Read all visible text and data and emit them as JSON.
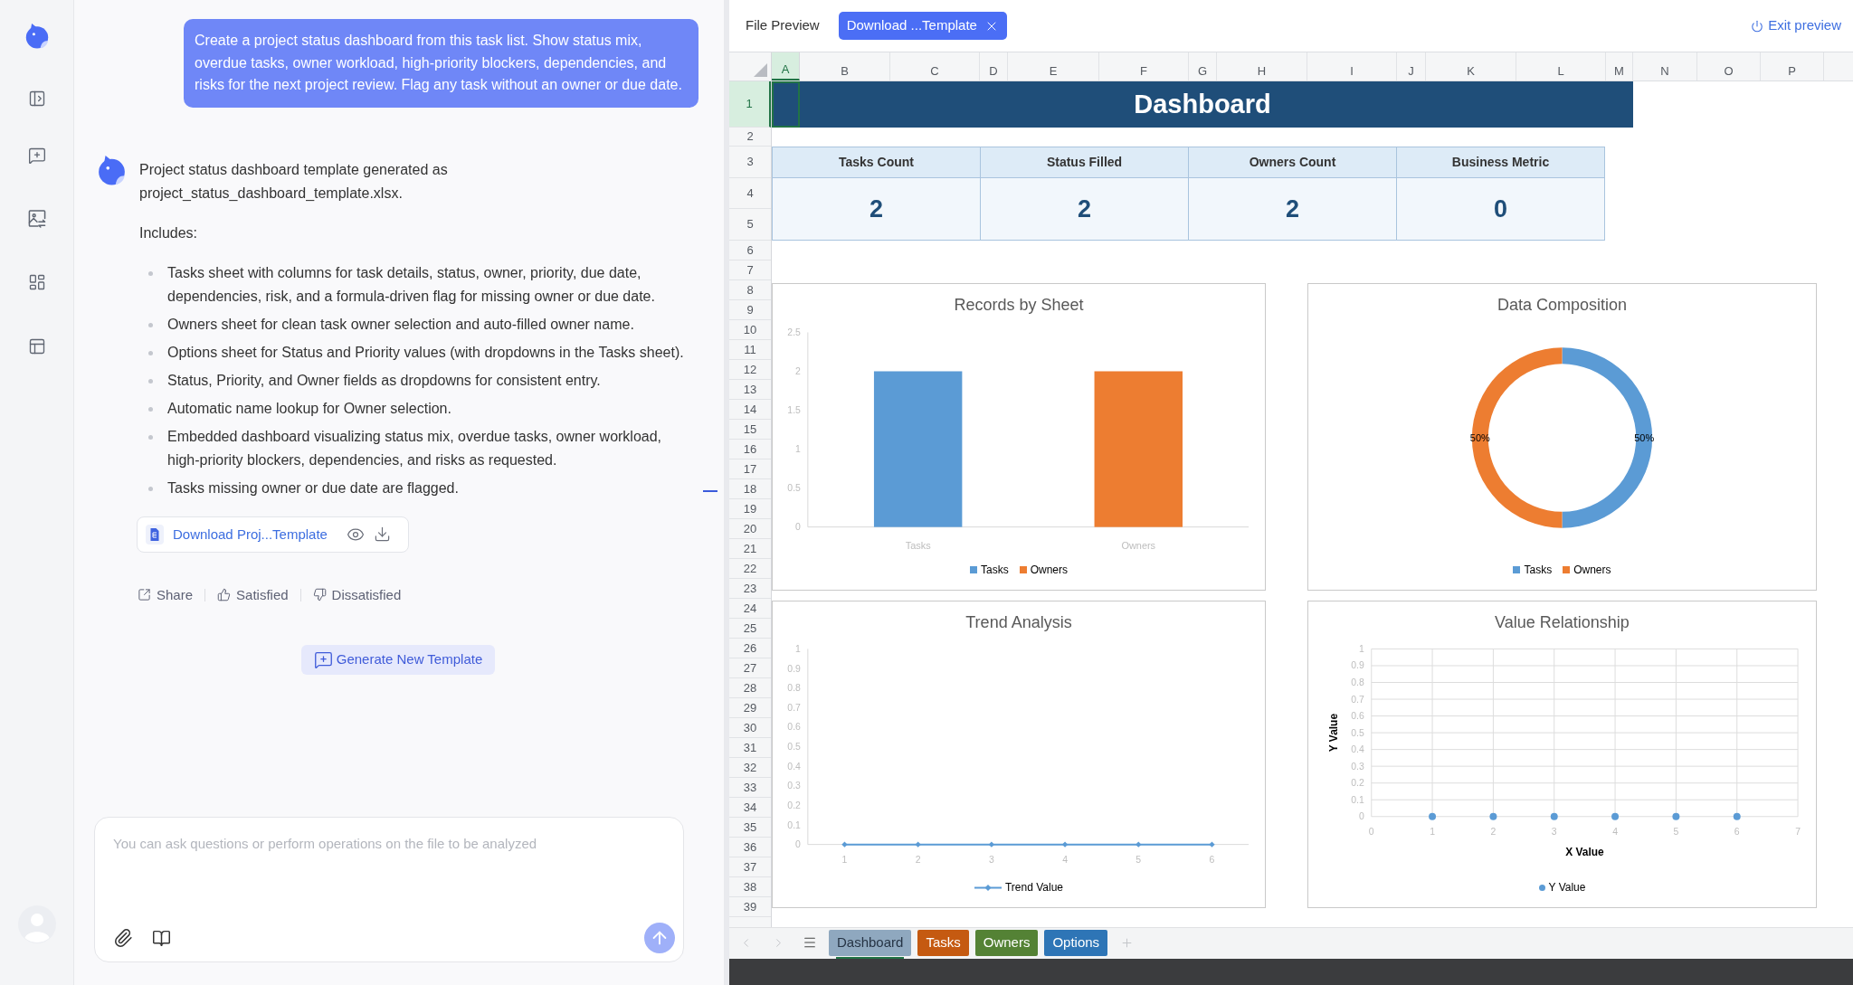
{
  "chat": {
    "user_message": "Create a project status dashboard from this task list. Show status mix, overdue tasks, owner workload, high-priority blockers, dependencies, and risks for the next project review. Flag any task without an owner or due date.",
    "reply": {
      "intro": "Project status dashboard template generated as project_status_dashboard_template.xlsx.",
      "list_heading": "Includes:",
      "bullets": [
        "Tasks sheet with columns for task details, status, owner, priority, due date, dependencies, risk, and a formula-driven flag for missing owner or due date.",
        "Owners sheet for clean task owner selection and auto-filled owner name.",
        "Options sheet for Status and Priority values (with dropdowns in the Tasks sheet).",
        "Status, Priority, and Owner fields as dropdowns for consistent entry.",
        "Automatic name lookup for Owner selection.",
        "Embedded dashboard visualizing status mix, overdue tasks, owner workload, high-priority blockers, dependencies, and risks as requested.",
        "Tasks missing owner or due date are flagged."
      ],
      "attachment": {
        "label": "Download Proj...Template"
      },
      "actions": [
        {
          "kind": "share",
          "label": "Share"
        },
        {
          "kind": "like",
          "label": "Satisfied"
        },
        {
          "kind": "dislike",
          "label": "Dissatisfied"
        }
      ]
    },
    "generate_button": {
      "label": "Generate New Template"
    },
    "composer": {
      "placeholder": "You can ask questions or perform operations on the file to be analyzed"
    }
  },
  "preview": {
    "title": "File Preview",
    "file_tab": {
      "label": "Download ...Template"
    },
    "exit_button": {
      "label": "Exit preview"
    },
    "columns": [
      {
        "label": "A",
        "selected": true
      },
      {
        "label": "B",
        "selected": false
      },
      {
        "label": "C",
        "selected": false
      },
      {
        "label": "D",
        "selected": false
      },
      {
        "label": "E",
        "selected": false
      },
      {
        "label": "F",
        "selected": false
      },
      {
        "label": "G",
        "selected": false
      },
      {
        "label": "H",
        "selected": false
      },
      {
        "label": "I",
        "selected": false
      },
      {
        "label": "J",
        "selected": false
      },
      {
        "label": "K",
        "selected": false
      },
      {
        "label": "L",
        "selected": false
      },
      {
        "label": "M",
        "selected": false
      },
      {
        "label": "N",
        "selected": false
      },
      {
        "label": "O",
        "selected": false
      },
      {
        "label": "P",
        "selected": false
      }
    ],
    "rows": [
      {
        "label": "1",
        "selected": true
      },
      {
        "label": "2",
        "selected": false
      },
      {
        "label": "3",
        "selected": false
      },
      {
        "label": "4",
        "selected": false
      },
      {
        "label": "5",
        "selected": false
      },
      {
        "label": "6",
        "selected": false
      },
      {
        "label": "7",
        "selected": false
      },
      {
        "label": "8",
        "selected": false
      },
      {
        "label": "9",
        "selected": false
      },
      {
        "label": "10",
        "selected": false
      },
      {
        "label": "11",
        "selected": false
      },
      {
        "label": "12",
        "selected": false
      },
      {
        "label": "13",
        "selected": false
      },
      {
        "label": "14",
        "selected": false
      },
      {
        "label": "15",
        "selected": false
      },
      {
        "label": "16",
        "selected": false
      },
      {
        "label": "17",
        "selected": false
      },
      {
        "label": "18",
        "selected": false
      },
      {
        "label": "19",
        "selected": false
      },
      {
        "label": "20",
        "selected": false
      },
      {
        "label": "21",
        "selected": false
      },
      {
        "label": "22",
        "selected": false
      },
      {
        "label": "23",
        "selected": false
      },
      {
        "label": "24",
        "selected": false
      },
      {
        "label": "25",
        "selected": false
      },
      {
        "label": "26",
        "selected": false
      },
      {
        "label": "27",
        "selected": false
      },
      {
        "label": "28",
        "selected": false
      },
      {
        "label": "29",
        "selected": false
      },
      {
        "label": "30",
        "selected": false
      },
      {
        "label": "31",
        "selected": false
      },
      {
        "label": "32",
        "selected": false
      },
      {
        "label": "33",
        "selected": false
      },
      {
        "label": "34",
        "selected": false
      },
      {
        "label": "35",
        "selected": false
      },
      {
        "label": "36",
        "selected": false
      },
      {
        "label": "37",
        "selected": false
      },
      {
        "label": "38",
        "selected": false
      },
      {
        "label": "39",
        "selected": false
      }
    ],
    "sheet": {
      "title": "Dashboard",
      "metrics": [
        {
          "label": "Tasks Count",
          "value": "2"
        },
        {
          "label": "Status Filled",
          "value": "2"
        },
        {
          "label": "Owners Count",
          "value": "2"
        },
        {
          "label": "Business Metric",
          "value": "0"
        }
      ],
      "charts": [
        {
          "chart_data": {
            "type": "bar",
            "title": "Records by Sheet",
            "categories": [
              "Tasks",
              "Owners"
            ],
            "series": [
              {
                "name": "Tasks",
                "color": "#5b9bd5",
                "values": [
                  2,
                  0
                ]
              },
              {
                "name": "Owners",
                "color": "#ed7d31",
                "values": [
                  0,
                  2
                ]
              }
            ],
            "stacked": true,
            "ylim": [
              0,
              2.5
            ],
            "yticks": [
              0,
              0.5,
              1,
              1.5,
              2,
              2.5
            ],
            "legend": "bottom"
          }
        },
        {
          "chart_data": {
            "type": "donut",
            "title": "Data Composition",
            "categories": [
              "Tasks",
              "Owners"
            ],
            "values": [
              50,
              50
            ],
            "colors": [
              "#5b9bd5",
              "#ed7d31"
            ],
            "value_labels": [
              "50%",
              "50%"
            ],
            "legend": "bottom"
          }
        },
        {
          "chart_data": {
            "type": "line",
            "title": "Trend Analysis",
            "categories": [
              "1",
              "2",
              "3",
              "4",
              "5",
              "6"
            ],
            "series": [
              {
                "name": "Trend Value",
                "color": "#5b9bd5",
                "marker": "diamond",
                "values": [
                  0,
                  0,
                  0,
                  0,
                  0,
                  0
                ]
              }
            ],
            "ylim": [
              0,
              1
            ],
            "yticks": [
              0,
              0.1,
              0.2,
              0.3,
              0.4,
              0.5,
              0.6,
              0.7,
              0.8,
              0.9,
              1
            ],
            "legend": "bottom"
          }
        },
        {
          "chart_data": {
            "type": "scatter",
            "title": "Value Relationship",
            "xlabel": "X Value",
            "ylabel": "Y Value",
            "x": [
              1,
              2,
              3,
              4,
              5,
              6
            ],
            "series": [
              {
                "name": "Y Value",
                "color": "#5b9bd5",
                "values": [
                  0,
                  0,
                  0,
                  0,
                  0,
                  0
                ]
              }
            ],
            "xlim": [
              0,
              7
            ],
            "ylim": [
              0,
              1
            ],
            "xticks": [
              0,
              1,
              2,
              3,
              4,
              5,
              6,
              7
            ],
            "yticks": [
              0,
              0.1,
              0.2,
              0.3,
              0.4,
              0.5,
              0.6,
              0.7,
              0.8,
              0.9,
              1
            ],
            "grid": true,
            "legend": "bottom"
          }
        }
      ]
    },
    "sheet_tabs": [
      {
        "label": "Dashboard",
        "color": "#8fa8bf",
        "selected": true
      },
      {
        "label": "Tasks",
        "color": "#c55a11",
        "selected": false
      },
      {
        "label": "Owners",
        "color": "#548235",
        "selected": false
      },
      {
        "label": "Options",
        "color": "#2e75b6",
        "selected": false
      }
    ]
  }
}
